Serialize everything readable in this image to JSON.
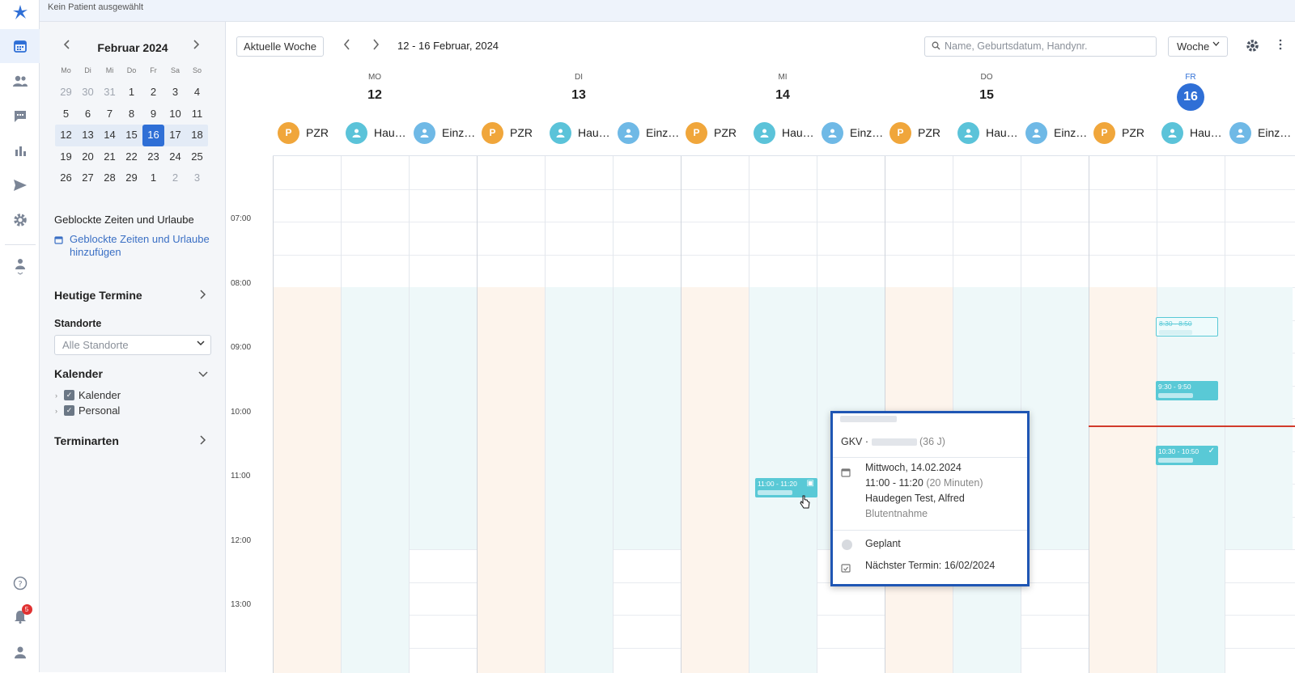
{
  "topbar": {
    "patient_status": "Kein Patient ausgewählt"
  },
  "rail": {
    "items": [
      "calendar-icon",
      "patients-icon",
      "messages-icon",
      "stats-icon",
      "send-icon",
      "settings-icon",
      "staff-icon"
    ],
    "bottom": [
      "help-icon",
      "bell-icon",
      "user-icon"
    ],
    "notification_count": "5"
  },
  "mini_calendar": {
    "title": "Februar 2024",
    "weekdays": [
      "Mo",
      "Di",
      "Mi",
      "Do",
      "Fr",
      "Sa",
      "So"
    ],
    "weeks": [
      [
        "29",
        "30",
        "31",
        "1",
        "2",
        "3",
        "4"
      ],
      [
        "5",
        "6",
        "7",
        "8",
        "9",
        "10",
        "11"
      ],
      [
        "12",
        "13",
        "14",
        "15",
        "16",
        "17",
        "18"
      ],
      [
        "19",
        "20",
        "21",
        "22",
        "23",
        "24",
        "25"
      ],
      [
        "26",
        "27",
        "28",
        "29",
        "1",
        "2",
        "3"
      ]
    ],
    "today": "16"
  },
  "sidebar": {
    "blocked_title": "Geblockte Zeiten und Urlaube",
    "blocked_link": "Geblockte Zeiten und Urlaube hinzufügen",
    "today_appts": "Heutige Termine",
    "locations_label": "Standorte",
    "locations_value": "Alle Standorte",
    "calendars_title": "Kalender",
    "calendar_items": [
      "Kalender",
      "Personal"
    ],
    "appt_types": "Terminarten"
  },
  "toolbar": {
    "current_week": "Aktuelle Woche",
    "range": "12 - 16 Februar, 2024",
    "search_placeholder": "Name, Geburtsdatum, Handynr.",
    "view": "Woche"
  },
  "calendar": {
    "days": [
      {
        "wd": "MO",
        "num": "12"
      },
      {
        "wd": "DI",
        "num": "13"
      },
      {
        "wd": "MI",
        "num": "14"
      },
      {
        "wd": "DO",
        "num": "15"
      },
      {
        "wd": "FR",
        "num": "16",
        "today": true
      }
    ],
    "resources": [
      "PZR",
      "Hau…",
      "Einz…"
    ],
    "times": [
      "07:00",
      "08:00",
      "09:00",
      "10:00",
      "11:00",
      "12:00",
      "13:00"
    ],
    "appointments": [
      {
        "label": "11:00 - 11:20"
      },
      {
        "label": "8:30 - 8:50"
      },
      {
        "label": "9:30 - 9:50"
      },
      {
        "label": "10:30 - 10:50"
      }
    ]
  },
  "popover": {
    "insurance": "GKV ·",
    "age": "(36 J)",
    "date": "Mittwoch, 14.02.2024",
    "time": "11:00 - 11:20",
    "duration": "(20 Minuten)",
    "doctor": "Haudegen Test, Alfred",
    "treatment": "Blutentnahme",
    "status": "Geplant",
    "next": "Nächster Termin: 16/02/2024"
  },
  "colors": {
    "accent": "#2f6fd6",
    "pzr": "#f0a63b",
    "hau": "#5bc3d9",
    "now": "#d23b2b"
  }
}
